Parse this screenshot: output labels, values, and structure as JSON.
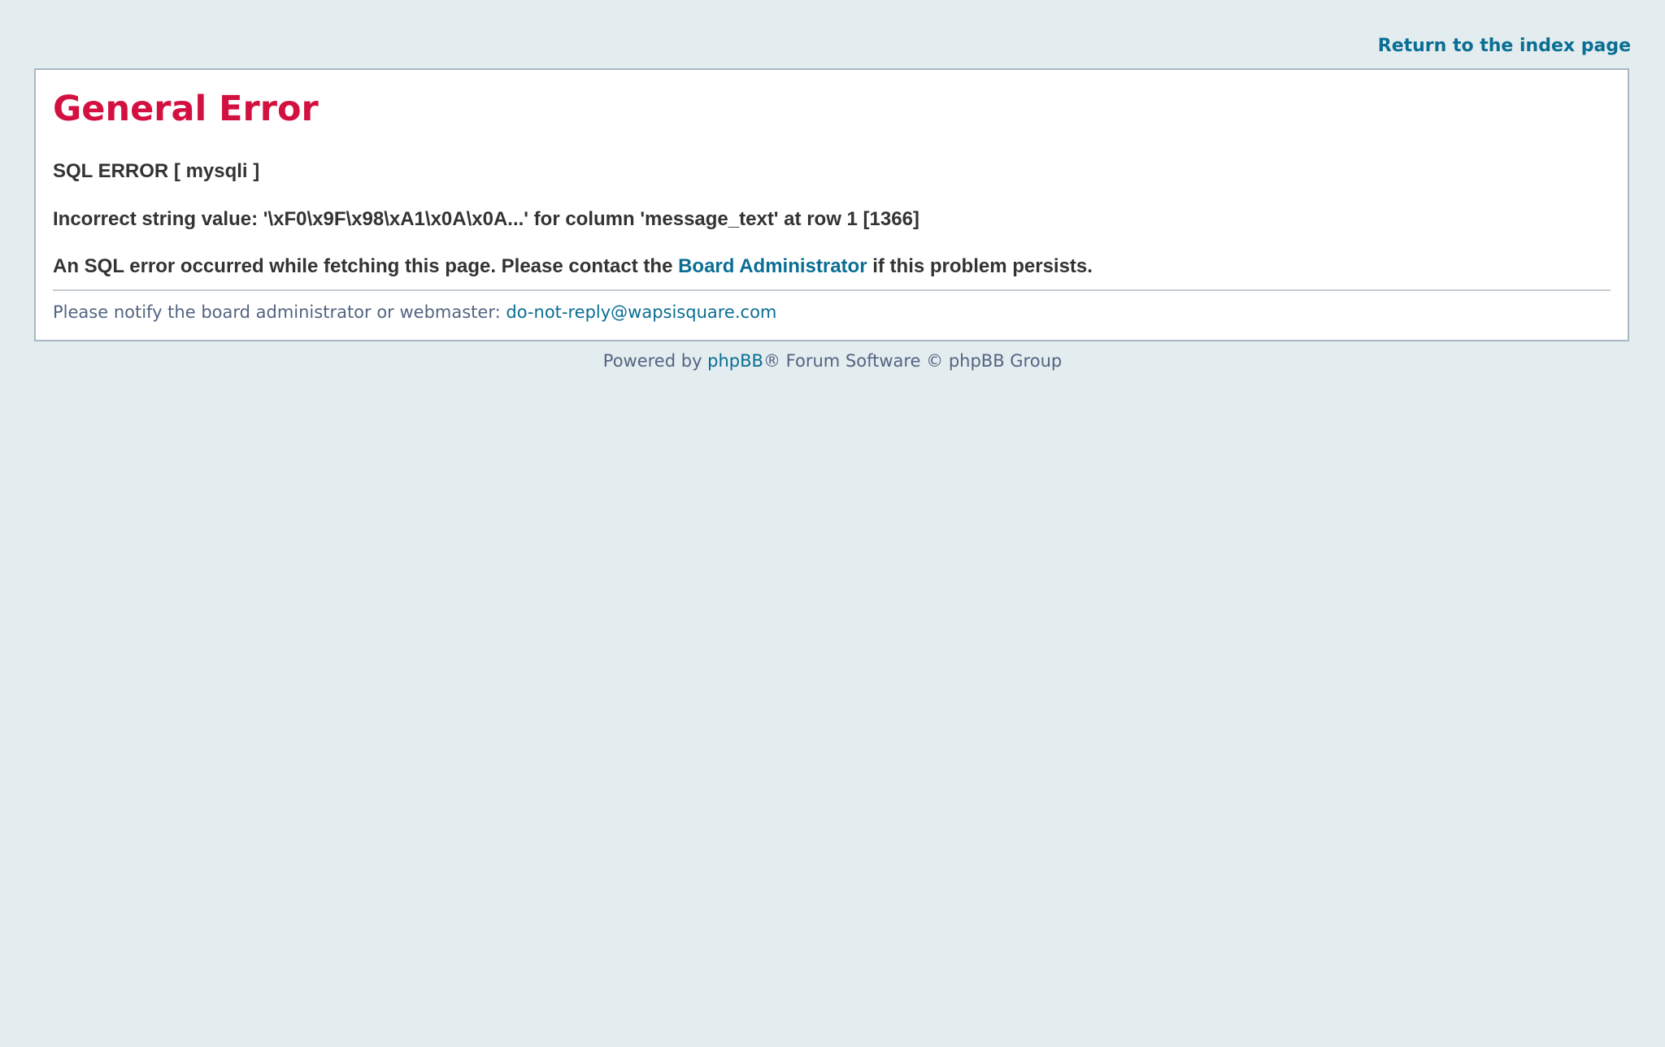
{
  "header": {
    "return_link": "Return to the index page"
  },
  "error_panel": {
    "title": "General Error",
    "sql_error": "SQL ERROR [ mysqli ]",
    "detail": "Incorrect string value: '\\xF0\\x9F\\x98\\xA1\\x0A\\x0A...' for column 'message_text' at row 1 [1366]",
    "message_prefix": "An SQL error occurred while fetching this page. Please contact the ",
    "message_link": "Board Administrator",
    "message_suffix": " if this problem persists.",
    "notify_text": "Please notify the board administrator or webmaster: ",
    "notify_email": "do-not-reply@wapsisquare.com"
  },
  "footer": {
    "prefix": "Powered by ",
    "link": "phpBB",
    "suffix": "® Forum Software © phpBB Group"
  },
  "colors": {
    "background": "#e3ecef",
    "title": "#d31141",
    "link": "#0a6e94",
    "muted_text": "#536482",
    "panel_border": "#a9b8c2"
  }
}
